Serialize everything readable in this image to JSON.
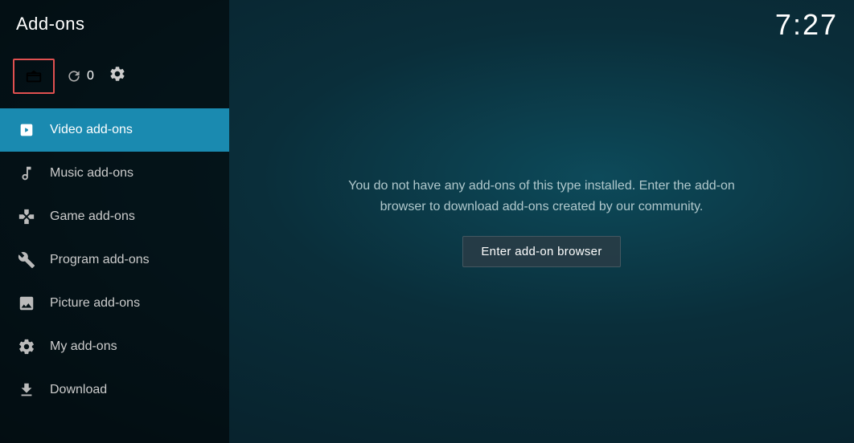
{
  "header": {
    "title": "Add-ons",
    "clock": "7:27"
  },
  "toolbar": {
    "update_count": "0"
  },
  "sidebar": {
    "items": [
      {
        "id": "video",
        "label": "Video add-ons",
        "icon": "video-icon",
        "active": true
      },
      {
        "id": "music",
        "label": "Music add-ons",
        "icon": "music-icon",
        "active": false
      },
      {
        "id": "game",
        "label": "Game add-ons",
        "icon": "game-icon",
        "active": false
      },
      {
        "id": "program",
        "label": "Program add-ons",
        "icon": "program-icon",
        "active": false
      },
      {
        "id": "picture",
        "label": "Picture add-ons",
        "icon": "picture-icon",
        "active": false
      },
      {
        "id": "my",
        "label": "My add-ons",
        "icon": "my-icon",
        "active": false
      },
      {
        "id": "download",
        "label": "Download",
        "icon": "download-icon",
        "active": false
      }
    ]
  },
  "main": {
    "empty_text": "You do not have any add-ons of this type installed. Enter the add-on browser to download add-ons created by our community.",
    "browser_button_label": "Enter add-on browser"
  }
}
